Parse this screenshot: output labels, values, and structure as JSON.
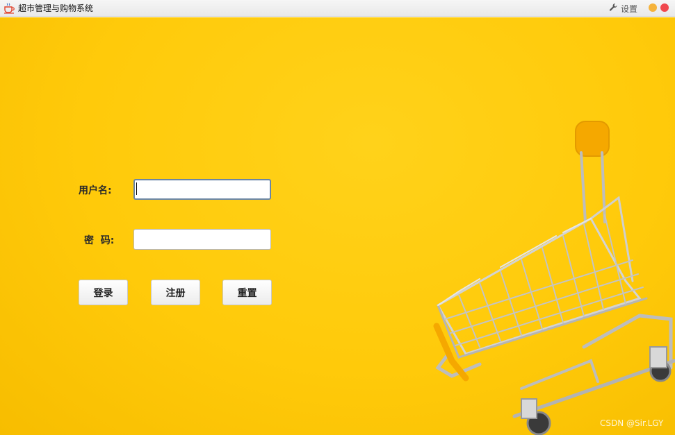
{
  "window": {
    "title": "超市管理与购物系统",
    "settings_label": "设置"
  },
  "login": {
    "username_label": "用户名:",
    "password_label": "密  码:",
    "username_value": "",
    "password_value": "",
    "buttons": {
      "login": "登录",
      "register": "注册",
      "reset": "重置"
    }
  },
  "watermark": "CSDN @Sir.LGY",
  "colors": {
    "background": "#ffca0a",
    "minimize": "#f5b33c",
    "close": "#f0484e",
    "cart_handle": "#f5a800"
  },
  "icons": {
    "app": "coffee-cup-icon",
    "settings": "wrench-icon"
  }
}
